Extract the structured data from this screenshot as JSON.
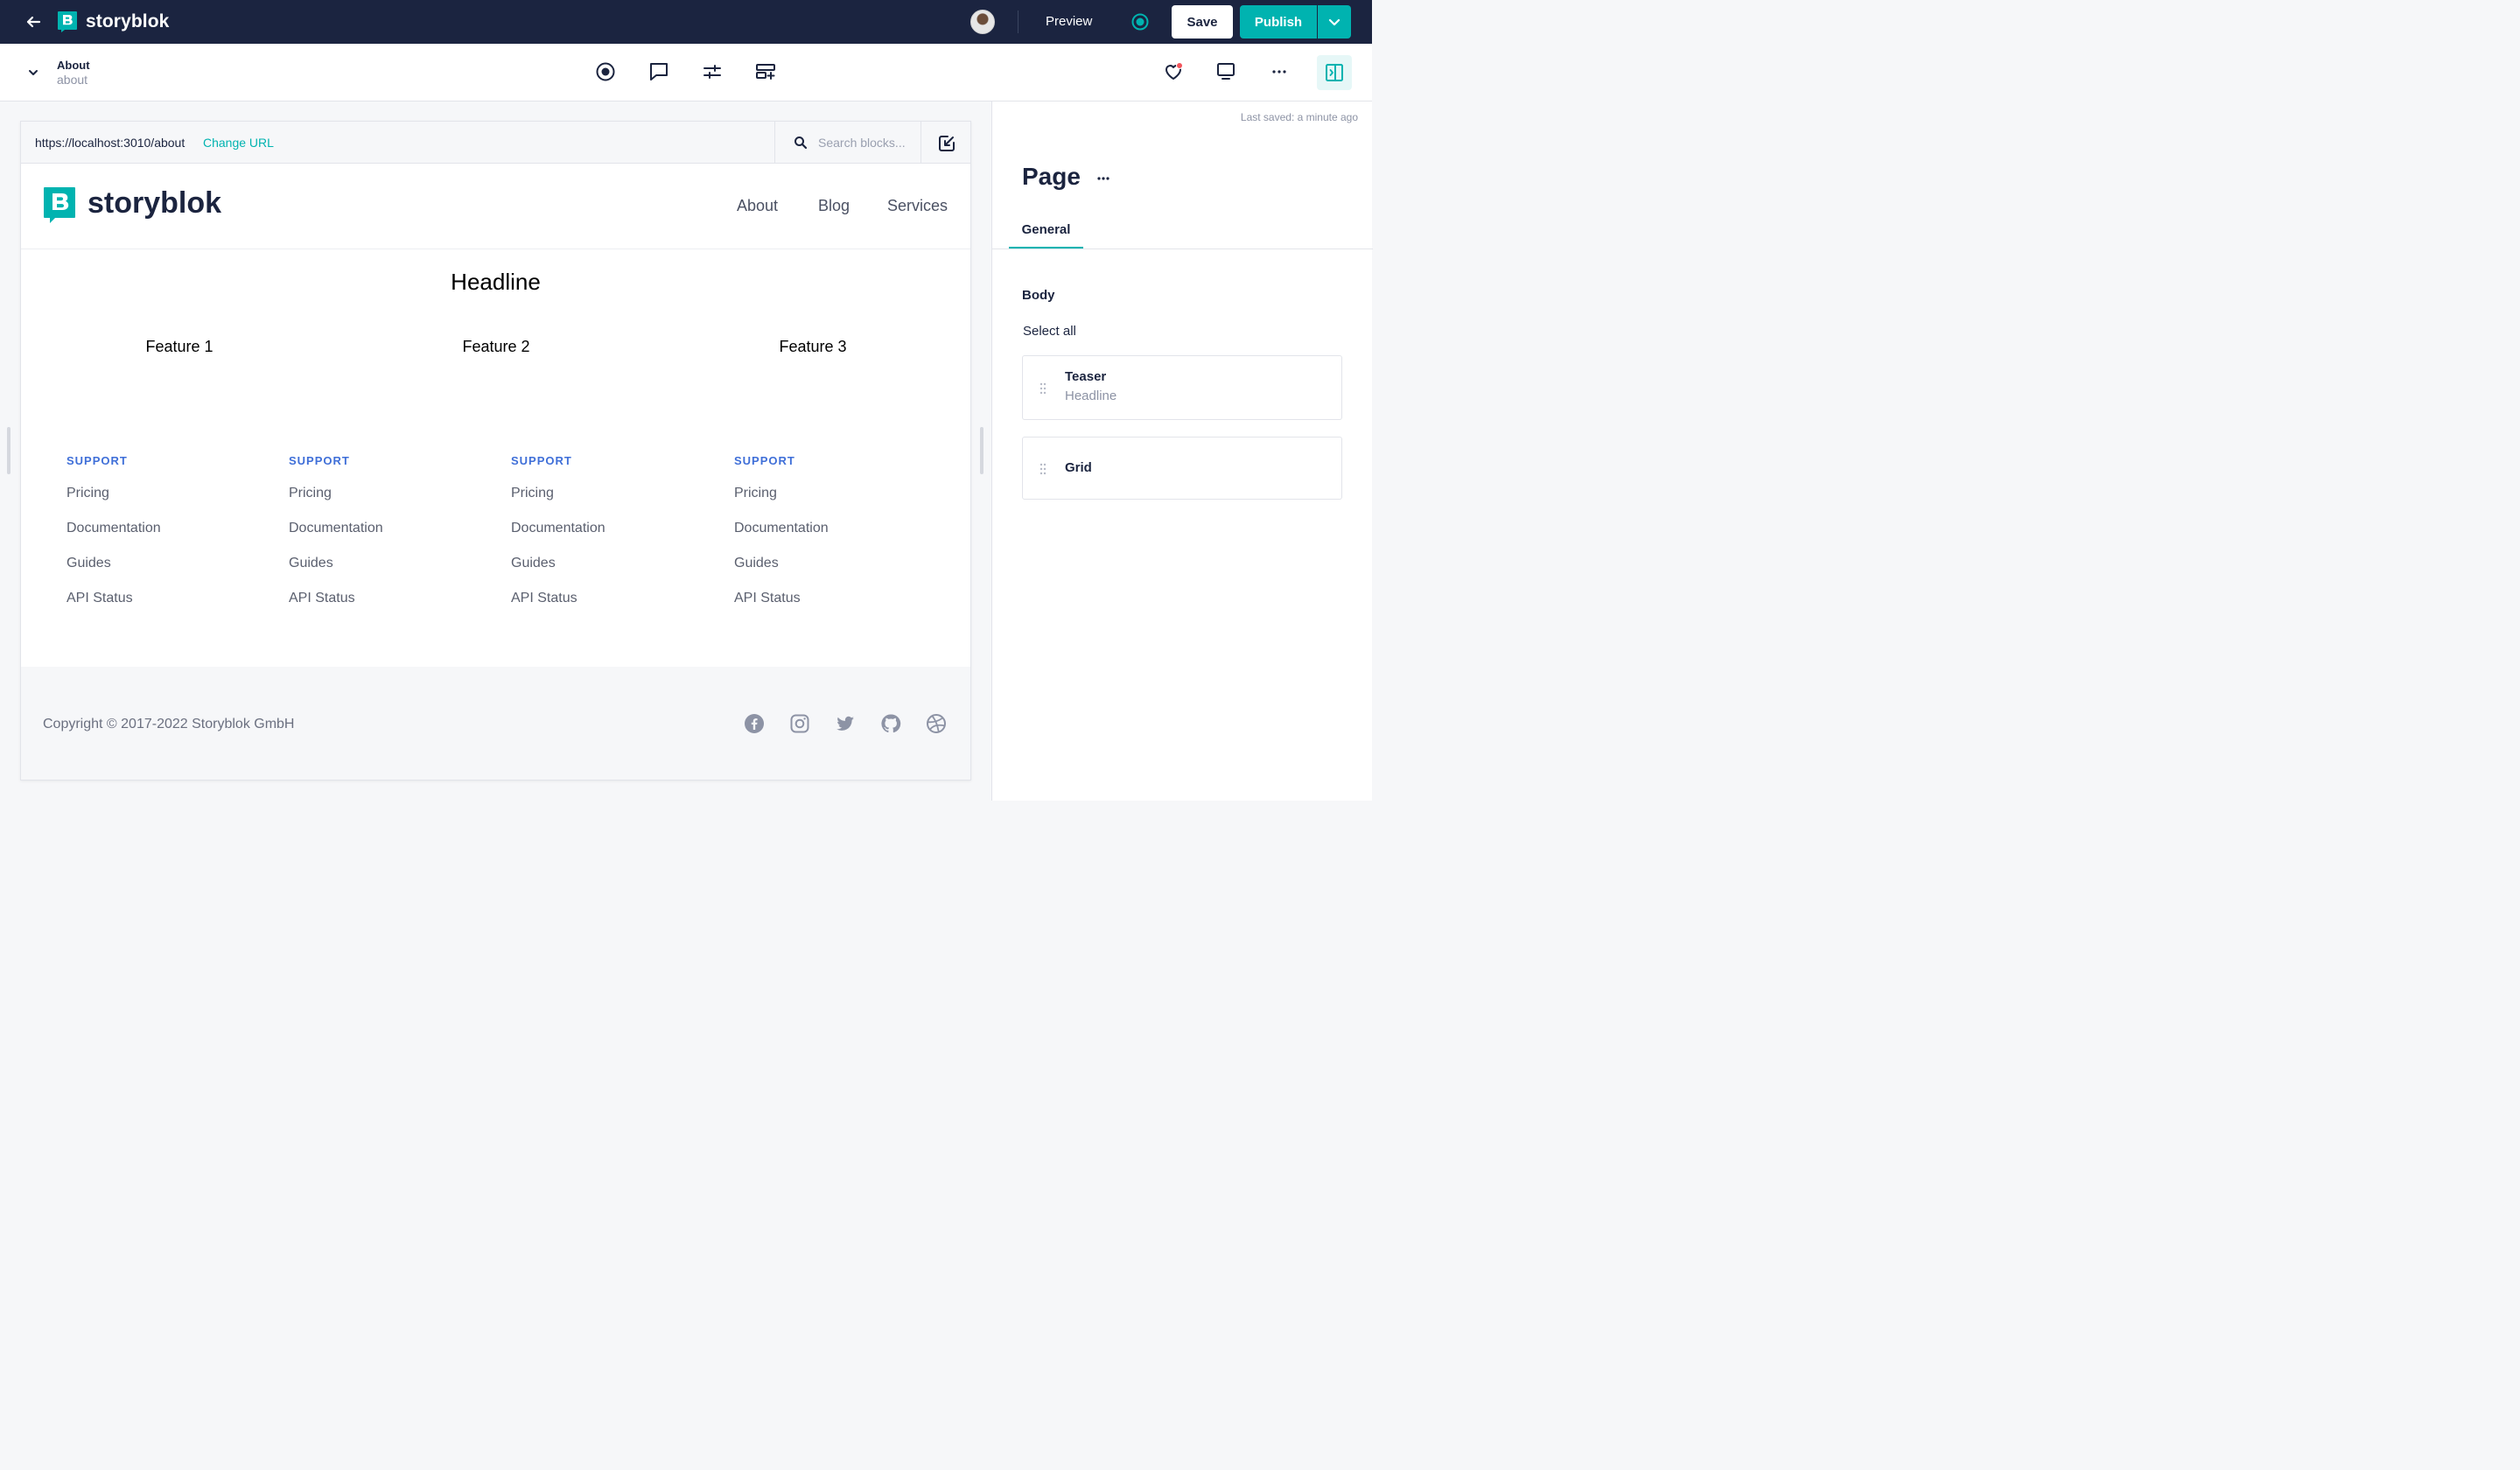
{
  "topbar": {
    "brand": "storyblok",
    "preview_label": "Preview",
    "save_label": "Save",
    "publish_label": "Publish"
  },
  "story": {
    "title": "About",
    "slug": "about"
  },
  "preview": {
    "url": "https://localhost:3010/about",
    "change_url_label": "Change URL",
    "search_placeholder": "Search blocks...",
    "site": {
      "brand": "storyblok",
      "nav": [
        "About",
        "Blog",
        "Services"
      ],
      "headline": "Headline",
      "features": [
        "Feature 1",
        "Feature 2",
        "Feature 3"
      ],
      "footer_columns": [
        {
          "heading": "SUPPORT",
          "links": [
            "Pricing",
            "Documentation",
            "Guides",
            "API Status"
          ]
        },
        {
          "heading": "SUPPORT",
          "links": [
            "Pricing",
            "Documentation",
            "Guides",
            "API Status"
          ]
        },
        {
          "heading": "SUPPORT",
          "links": [
            "Pricing",
            "Documentation",
            "Guides",
            "API Status"
          ]
        },
        {
          "heading": "SUPPORT",
          "links": [
            "Pricing",
            "Documentation",
            "Guides",
            "API Status"
          ]
        }
      ],
      "copyright": "Copyright © 2017-2022  Storyblok GmbH",
      "social_icons": [
        "facebook-icon",
        "instagram-icon",
        "twitter-icon",
        "github-icon",
        "dribbble-icon"
      ]
    }
  },
  "panel": {
    "last_saved": "Last saved: a minute ago",
    "title": "Page",
    "tabs": [
      "General"
    ],
    "body_label": "Body",
    "select_all_label": "Select all",
    "blocks": [
      {
        "name": "Teaser",
        "subtitle": "Headline"
      },
      {
        "name": "Grid",
        "subtitle": ""
      }
    ]
  },
  "colors": {
    "topbar_bg": "#1b2440",
    "accent": "#00b3b0",
    "footer_heading": "#3f6fd8"
  }
}
